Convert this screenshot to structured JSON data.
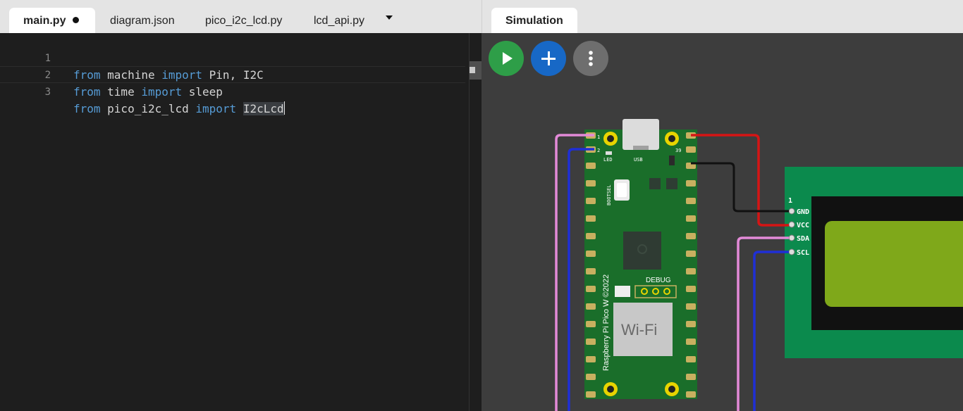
{
  "editor": {
    "tabs": [
      {
        "label": "main.py",
        "active": true,
        "modified": true
      },
      {
        "label": "diagram.json",
        "active": false
      },
      {
        "label": "pico_i2c_lcd.py",
        "active": false
      },
      {
        "label": "lcd_api.py",
        "active": false
      }
    ],
    "line_numbers": [
      "1",
      "2",
      "3"
    ],
    "code": {
      "line1": {
        "kw1": "from",
        "mod": " machine ",
        "kw2": "import",
        "rest": " Pin, I2C"
      },
      "line2": {
        "kw1": "from",
        "mod": " time ",
        "kw2": "import",
        "rest": " sleep"
      },
      "line3": {
        "kw1": "from",
        "mod": " pico_i2c_lcd ",
        "kw2": "import",
        "sp": " ",
        "sel": "I2cLcd"
      }
    }
  },
  "simulation": {
    "tab_label": "Simulation",
    "buttons": {
      "play": "play-icon",
      "add": "plus-icon",
      "more": "more-vertical-icon"
    },
    "board": {
      "name": "Raspberry Pi Pico W ©2022",
      "led_label": "LED",
      "usb_label": "USB",
      "bootsel_label": "BOOTSEL",
      "debug_label": "DEBUG",
      "wifi_label": "Wi-Fi",
      "pin_1": "1",
      "pin_2": "2",
      "pin_39": "39"
    },
    "lcd": {
      "pin_index": "1",
      "pins": [
        "GND",
        "VCC",
        "SDA",
        "SCL"
      ]
    },
    "colors": {
      "board_green": "#1a6e2a",
      "wire_red": "#d51515",
      "wire_black": "#111111",
      "wire_pink": "#e38ad8",
      "wire_blue": "#1f2fd6",
      "lcd_green": "#0b8a4d",
      "lcd_screen": "#7fa81a"
    }
  }
}
